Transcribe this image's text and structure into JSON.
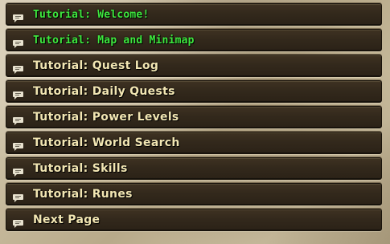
{
  "menu": {
    "items": [
      {
        "label": "Tutorial: Welcome!",
        "icon": "speech-bubble-icon",
        "state": "visited"
      },
      {
        "label": "Tutorial: Map and Minimap",
        "icon": "speech-bubble-icon",
        "state": "visited"
      },
      {
        "label": "Tutorial: Quest Log",
        "icon": "speech-bubble-icon",
        "state": "new"
      },
      {
        "label": "Tutorial: Daily Quests",
        "icon": "speech-bubble-icon",
        "state": "new"
      },
      {
        "label": "Tutorial: Power Levels",
        "icon": "speech-bubble-icon",
        "state": "new"
      },
      {
        "label": "Tutorial: World Search",
        "icon": "speech-bubble-icon",
        "state": "new"
      },
      {
        "label": "Tutorial: Skills",
        "icon": "speech-bubble-icon",
        "state": "new"
      },
      {
        "label": "Tutorial: Runes",
        "icon": "speech-bubble-icon",
        "state": "new"
      },
      {
        "label": "Next Page",
        "icon": "speech-bubble-icon",
        "state": "new"
      }
    ]
  },
  "colors": {
    "visited_text": "#3ee83e",
    "new_text": "#f2e6b3",
    "row_background": "#33291c"
  }
}
